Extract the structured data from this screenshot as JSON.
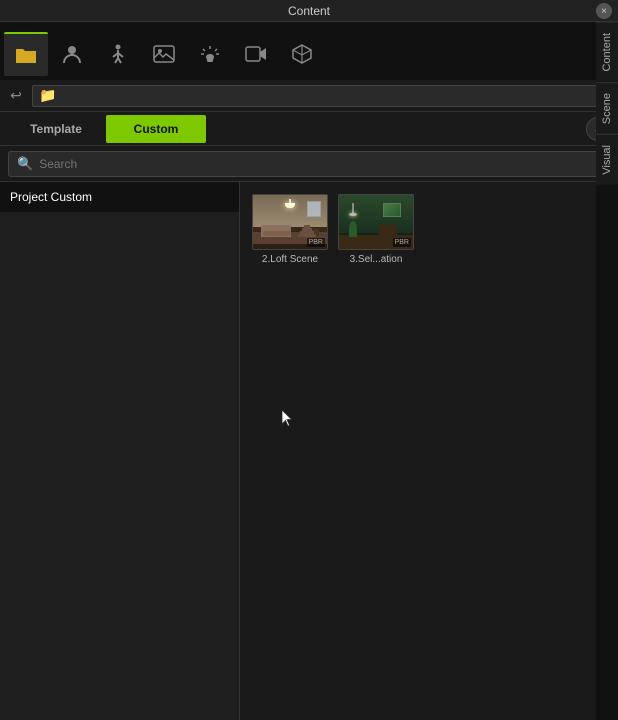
{
  "titleBar": {
    "title": "Content",
    "closeLabel": "×"
  },
  "toolbar": {
    "icons": [
      {
        "name": "folder",
        "symbol": "📁",
        "active": true
      },
      {
        "name": "person",
        "symbol": "👤",
        "active": false
      },
      {
        "name": "figure",
        "symbol": "🚶",
        "active": false
      },
      {
        "name": "image",
        "symbol": "🖼",
        "active": false
      },
      {
        "name": "lamp",
        "symbol": "💡",
        "active": false
      },
      {
        "name": "video",
        "symbol": "🎬",
        "active": false
      },
      {
        "name": "box",
        "symbol": "📦",
        "active": false
      }
    ]
  },
  "addressBar": {
    "backLabel": "↩",
    "folderSymbol": "📁",
    "path": ""
  },
  "tabs": {
    "template": "Template",
    "custom": "Custom"
  },
  "search": {
    "placeholder": "Search",
    "icon": "🔍"
  },
  "leftPanel": {
    "items": [
      {
        "label": "Project Custom",
        "selected": true
      }
    ]
  },
  "rightPanel": {
    "items": [
      {
        "label": "2.Loft Scene",
        "badge": "PBR",
        "type": "loft"
      },
      {
        "label": "3.Sel...ation",
        "badge": "PBR",
        "type": "sel"
      }
    ]
  },
  "rightSidebar": {
    "tabs": [
      {
        "label": "Content"
      },
      {
        "label": "Scene"
      },
      {
        "label": "Visual"
      }
    ]
  },
  "dropdown": {
    "symbol": "⌄"
  }
}
